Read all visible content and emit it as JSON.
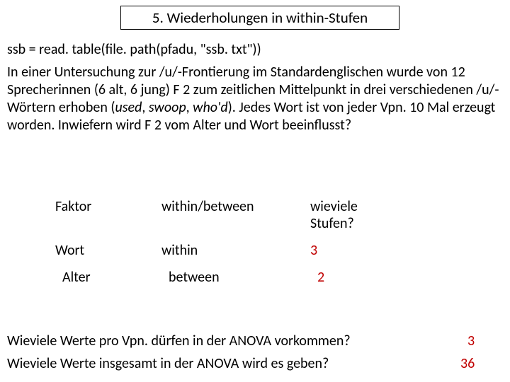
{
  "title": "5. Wiederholungen in within-Stufen",
  "code": "ssb = read. table(file. path(pfadu, \"ssb. txt\"))",
  "para_parts": {
    "p1": "In einer Untersuchung zur /u/-Frontierung im Standardenglischen wurde von 12 Sprecherinnen (6 alt, 6 jung) F 2 zum zeitlichen Mittelpunkt in drei verschiedenen /u/-Wörtern erhoben (",
    "w1": "used",
    "c1": ", ",
    "w2": "swoop",
    "c2": ", ",
    "w3": "who'd",
    "p2": "). Jedes Wort ist von jeder Vpn. 10 Mal erzeugt worden. Inwiefern wird F 2 vom Alter und Wort beeinflusst?"
  },
  "table": {
    "h1": "Faktor",
    "h2": "within/between",
    "h3a": "wieviele",
    "h3b": "Stufen?",
    "r1c1": "Wort",
    "r1c2": "within",
    "r1c3": "3",
    "r2c1": "Alter",
    "r2c2": "between",
    "r2c3": "2"
  },
  "q1": "Wieviele Werte pro Vpn. dürfen in der ANOVA vorkommen?",
  "a1": "3",
  "q2": "Wieviele Werte insgesamt in der ANOVA  wird es geben?",
  "a2": "36"
}
